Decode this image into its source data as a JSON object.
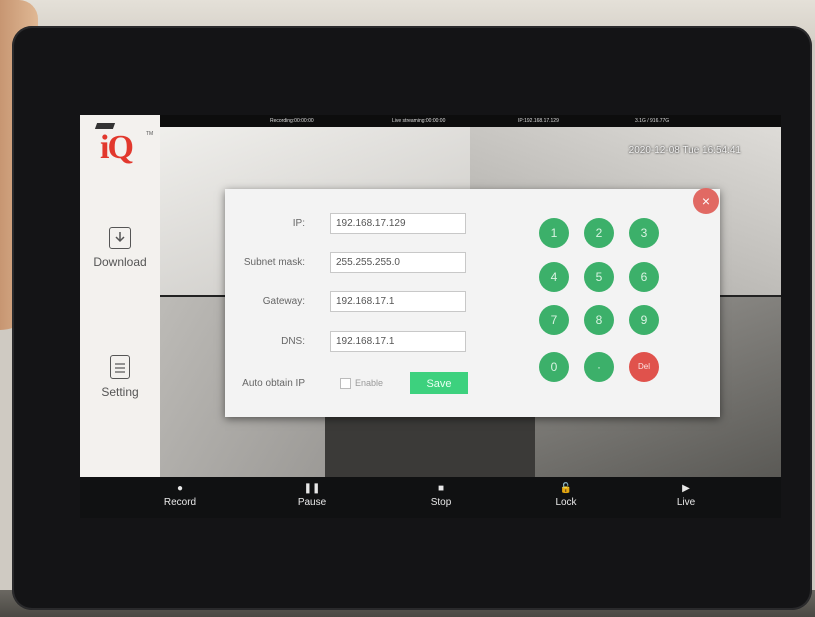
{
  "status_bar": {
    "recording": "Recording:00:00:00",
    "live_streaming": "Live streaming:00:00:00",
    "ip": "IP:192.168.17.129",
    "storage": "3.1G / 916.77G",
    "datetime": "2020-12-08 Tue 16:54:41"
  },
  "sidebar": {
    "logo": "iQ",
    "items": [
      {
        "label": "Download",
        "icon": "download-icon"
      },
      {
        "label": "Setting",
        "icon": "document-icon"
      }
    ]
  },
  "dialog": {
    "fields": [
      {
        "label": "IP:",
        "value": "192.168.17.129"
      },
      {
        "label": "Subnet mask:",
        "value": "255.255.255.0"
      },
      {
        "label": "Gateway:",
        "value": "192.168.17.1"
      },
      {
        "label": "DNS:",
        "value": "192.168.17.1"
      }
    ],
    "auto_obtain_label": "Auto obtain IP",
    "enable_label": "Enable",
    "save_label": "Save",
    "close_glyph": "×",
    "keypad": [
      "1",
      "2",
      "3",
      "4",
      "5",
      "6",
      "7",
      "8",
      "9",
      "0",
      "·",
      "Del"
    ]
  },
  "toolbar": {
    "items": [
      {
        "label": "Record",
        "icon": "record-icon",
        "glyph": "●"
      },
      {
        "label": "Pause",
        "icon": "pause-icon",
        "glyph": "❚❚"
      },
      {
        "label": "Stop",
        "icon": "stop-icon",
        "glyph": "■"
      },
      {
        "label": "Lock",
        "icon": "lock-icon",
        "glyph": "🔓"
      },
      {
        "label": "Live",
        "icon": "play-icon",
        "glyph": "▶"
      }
    ]
  },
  "colors": {
    "keypad_green": "#3cb06a",
    "delete_red": "#e0524c",
    "save_green": "#3dd17e",
    "logo_red": "#e2382d"
  }
}
